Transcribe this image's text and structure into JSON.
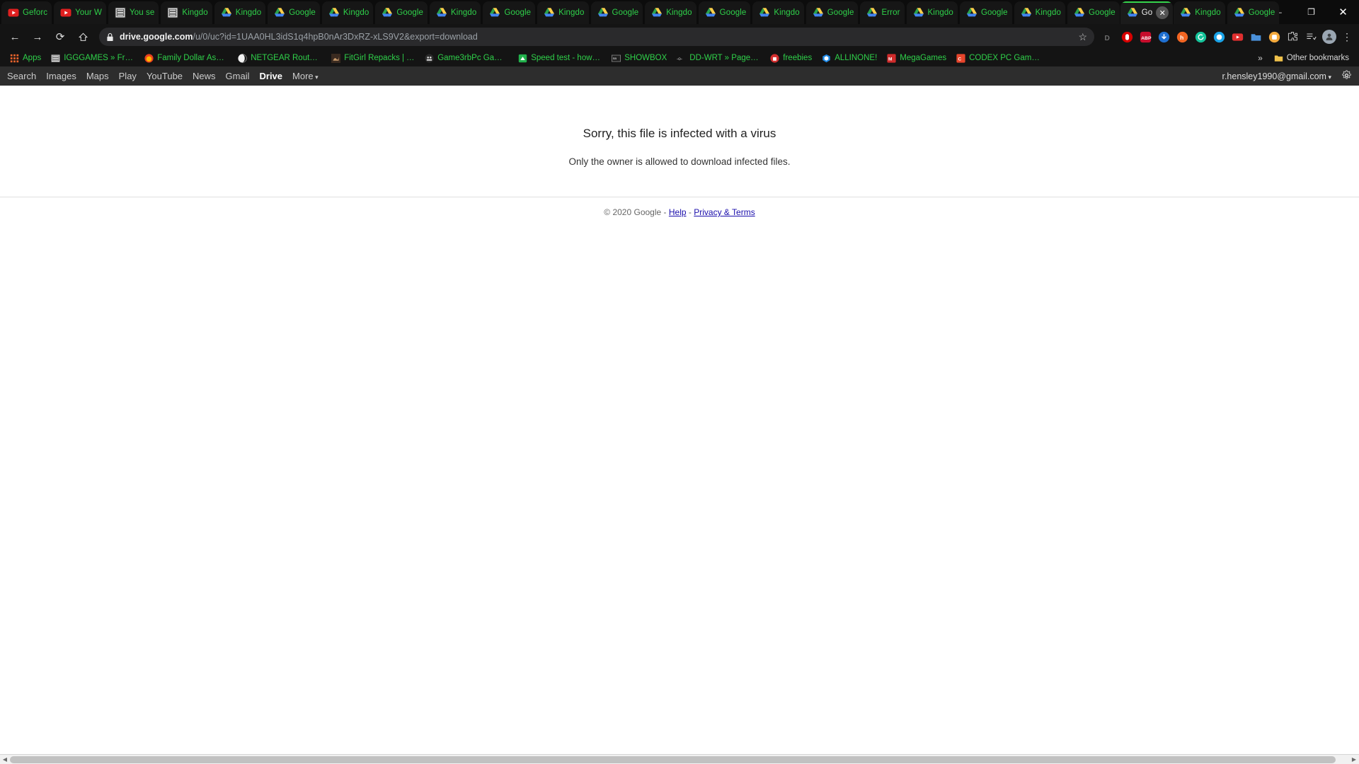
{
  "window": {
    "minimize_label": "–",
    "maximize_label": "❐",
    "close_label": "✕",
    "newtab_label": "+"
  },
  "tabs": [
    {
      "title": "Geforc",
      "icon": "youtube-icon",
      "active": false
    },
    {
      "title": "Your W",
      "icon": "youtube-icon",
      "active": false
    },
    {
      "title": "You se",
      "icon": "document-icon",
      "active": false
    },
    {
      "title": "Kingdo",
      "icon": "document-icon",
      "active": false
    },
    {
      "title": "Kingdo",
      "icon": "drive-icon",
      "active": false
    },
    {
      "title": "Google",
      "icon": "drive-icon",
      "active": false
    },
    {
      "title": "Kingdo",
      "icon": "drive-icon",
      "active": false
    },
    {
      "title": "Google",
      "icon": "drive-icon",
      "active": false
    },
    {
      "title": "Kingdo",
      "icon": "drive-icon",
      "active": false
    },
    {
      "title": "Google",
      "icon": "drive-icon",
      "active": false
    },
    {
      "title": "Kingdo",
      "icon": "drive-icon",
      "active": false
    },
    {
      "title": "Google",
      "icon": "drive-icon",
      "active": false
    },
    {
      "title": "Kingdo",
      "icon": "drive-icon",
      "active": false
    },
    {
      "title": "Google",
      "icon": "drive-icon",
      "active": false
    },
    {
      "title": "Kingdo",
      "icon": "drive-icon",
      "active": false
    },
    {
      "title": "Google",
      "icon": "drive-icon",
      "active": false
    },
    {
      "title": "Error",
      "icon": "drive-icon",
      "active": false
    },
    {
      "title": "Kingdo",
      "icon": "drive-icon",
      "active": false
    },
    {
      "title": "Google",
      "icon": "drive-icon",
      "active": false
    },
    {
      "title": "Kingdo",
      "icon": "drive-icon",
      "active": false
    },
    {
      "title": "Google",
      "icon": "drive-icon",
      "active": false
    },
    {
      "title": "Go",
      "icon": "drive-icon",
      "active": true
    },
    {
      "title": "Kingdo",
      "icon": "drive-icon",
      "active": false
    },
    {
      "title": "Google",
      "icon": "drive-icon",
      "active": false
    }
  ],
  "toolbar": {
    "back_label": "←",
    "forward_label": "→",
    "reload_label": "⟳",
    "home_label": "⌂",
    "lock_icon": "lock-icon",
    "url_domain": "drive.google.com",
    "url_path": "/u/0/uc?id=1UAA0HL3idS1q4hpB0nAr3DxRZ-xLS9V2&export=download",
    "star_label": "☆",
    "extensions": [
      {
        "name": "dashlane-extension-icon",
        "label": "D"
      },
      {
        "name": "adblock-hand-extension-icon",
        "label": "✋"
      },
      {
        "name": "adblock-plus-extension-icon",
        "label": "ABP"
      },
      {
        "name": "video-downloader-extension-icon",
        "label": "▼"
      },
      {
        "name": "honey-extension-icon",
        "label": "h"
      },
      {
        "name": "grammarly-extension-icon",
        "label": "G"
      },
      {
        "name": "ghostery-extension-icon",
        "label": "◐"
      },
      {
        "name": "youtube-extension-icon",
        "label": "▶"
      },
      {
        "name": "folder-extension-icon",
        "label": "⬚"
      },
      {
        "name": "puzzle-extension-icon",
        "label": "❖"
      }
    ],
    "puzzle_label": "🧩",
    "reading_list_label": "☰",
    "profile_label": "●",
    "menu_label": "⋮"
  },
  "bookmarks": {
    "apps_label": "Apps",
    "items": [
      {
        "label": "IGGGAMES » Free...",
        "icon": "igg-games-icon"
      },
      {
        "label": "Family Dollar Associ...",
        "icon": "family-dollar-icon"
      },
      {
        "label": "NETGEAR Router R...",
        "icon": "netgear-icon"
      },
      {
        "label": "FitGirl Repacks | Th...",
        "icon": "fitgirl-icon"
      },
      {
        "label": "Game3rbPc Games...",
        "icon": "game3rb-icon"
      },
      {
        "label": "Speed test - how fa...",
        "icon": "speedtest-icon"
      },
      {
        "label": "SHOWBOX",
        "icon": "showbox-icon"
      },
      {
        "label": "DD-WRT » Page no...",
        "icon": "ddwrt-icon"
      },
      {
        "label": "freebies",
        "icon": "freebies-icon"
      },
      {
        "label": "ALLINONE!",
        "icon": "allinone-icon"
      },
      {
        "label": "MegaGames",
        "icon": "megagames-icon"
      },
      {
        "label": "CODEX PC Games |...",
        "icon": "codex-icon"
      }
    ],
    "overflow_label": "»",
    "other_bookmarks_label": "Other bookmarks",
    "other_bookmarks_icon": "folder-icon"
  },
  "gnav": {
    "links": [
      {
        "label": "Search",
        "current": false
      },
      {
        "label": "Images",
        "current": false
      },
      {
        "label": "Maps",
        "current": false
      },
      {
        "label": "Play",
        "current": false
      },
      {
        "label": "YouTube",
        "current": false
      },
      {
        "label": "News",
        "current": false
      },
      {
        "label": "Gmail",
        "current": false
      },
      {
        "label": "Drive",
        "current": true
      },
      {
        "label": "More",
        "current": false
      }
    ],
    "account_email": "r.hensley1990@gmail.com",
    "settings_icon": "gear-icon"
  },
  "content": {
    "message_main": "Sorry, this file is infected with a virus",
    "message_sub": "Only the owner is allowed to download infected files."
  },
  "footer": {
    "copyright": "© 2020 Google",
    "separator": "-",
    "help_label": "Help",
    "privacy_label": "Privacy & Terms"
  },
  "scrollbar": {
    "left_arrow": "◀",
    "right_arrow": "▶"
  },
  "colors": {
    "tab_text": "#2fd14a",
    "chrome_bg": "#141414",
    "link": "#1a0dab"
  }
}
